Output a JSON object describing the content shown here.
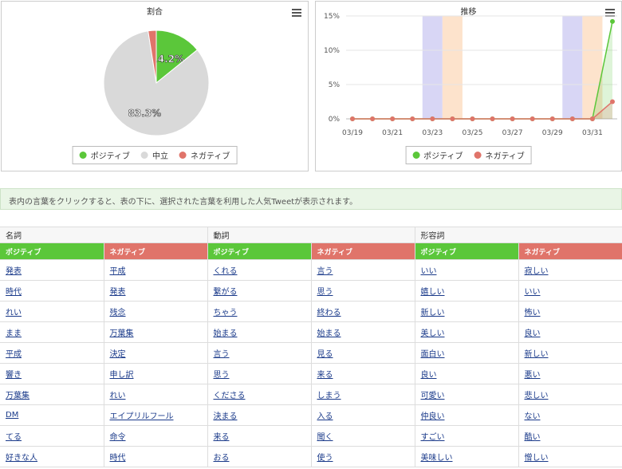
{
  "pie_panel": {
    "title": "割合",
    "legend": [
      {
        "label": "ポジティブ",
        "color": "#5bc73a"
      },
      {
        "label": "中立",
        "color": "#d9d9d9"
      },
      {
        "label": "ネガティブ",
        "color": "#e0746a"
      }
    ]
  },
  "line_panel": {
    "title": "推移",
    "legend": [
      {
        "label": "ポジティブ",
        "color": "#5bc73a"
      },
      {
        "label": "ネガティブ",
        "color": "#e0746a"
      }
    ]
  },
  "chart_data": [
    {
      "type": "pie",
      "slices": [
        {
          "name": "ポジティブ",
          "value": 14.2,
          "color": "#5bc73a",
          "label": "14.2%"
        },
        {
          "name": "中立",
          "value": 83.3,
          "color": "#d9d9d9",
          "label": "83.3%"
        },
        {
          "name": "ネガティブ",
          "value": 2.5,
          "color": "#e0746a",
          "label": ""
        }
      ]
    },
    {
      "type": "line",
      "x": [
        "03/19",
        "03/20",
        "03/21",
        "03/22",
        "03/23",
        "03/24",
        "03/25",
        "03/26",
        "03/27",
        "03/28",
        "03/29",
        "03/30",
        "03/31",
        "04/01"
      ],
      "x_tick_labels": [
        "03/19",
        "03/21",
        "03/23",
        "03/25",
        "03/27",
        "03/29",
        "03/31"
      ],
      "y_tick_labels": [
        "0%",
        "5%",
        "10%",
        "15%"
      ],
      "ylim": [
        0,
        15
      ],
      "grid": true,
      "highlight_bands": [
        {
          "from": "03/23",
          "to": "03/24",
          "colors": [
            "#d8d6f5",
            "#fde3cc"
          ]
        },
        {
          "from": "03/30",
          "to": "03/31",
          "colors": [
            "#d8d6f5",
            "#fde3cc"
          ]
        }
      ],
      "series": [
        {
          "name": "ポジティブ",
          "color": "#5bc73a",
          "values": [
            0,
            0,
            0,
            0,
            0,
            0,
            0,
            0,
            0,
            0,
            0,
            0,
            0,
            14.2
          ]
        },
        {
          "name": "ネガティブ",
          "color": "#e0746a",
          "values": [
            0,
            0,
            0,
            0,
            0,
            0,
            0,
            0,
            0,
            0,
            0,
            0,
            0,
            2.5
          ]
        }
      ]
    }
  ],
  "notice": "表内の言葉をクリックすると、表の下に、選択された言葉を利用した人気Tweetが表示されます。",
  "table": {
    "categories": [
      "名詞",
      "動詞",
      "形容詞"
    ],
    "headers": [
      "ポジティブ",
      "ネガティブ",
      "ポジティブ",
      "ネガティブ",
      "ポジティブ",
      "ネガティブ"
    ],
    "rows": [
      [
        "発表",
        "平成",
        "くれる",
        "言う",
        "いい",
        "寂しい"
      ],
      [
        "時代",
        "発表",
        "繋がる",
        "思う",
        "嬉しい",
        "いい"
      ],
      [
        "れい",
        "残念",
        "ちゃう",
        "終わる",
        "新しい",
        "怖い"
      ],
      [
        "まま",
        "万葉集",
        "始まる",
        "始まる",
        "美しい",
        "良い"
      ],
      [
        "平成",
        "決定",
        "言う",
        "見る",
        "面白い",
        "新しい"
      ],
      [
        "響き",
        "申し訳",
        "思う",
        "来る",
        "良い",
        "悪い"
      ],
      [
        "万葉集",
        "れい",
        "くださる",
        "しまう",
        "可愛い",
        "悲しい"
      ],
      [
        "DM",
        "エイプリルフール",
        "決まる",
        "入る",
        "仲良い",
        "ない"
      ],
      [
        "てる",
        "命令",
        "来る",
        "聞く",
        "すごい",
        "酷い"
      ],
      [
        "好きな人",
        "時代",
        "おる",
        "使う",
        "美味しい",
        "憎しい"
      ]
    ]
  }
}
